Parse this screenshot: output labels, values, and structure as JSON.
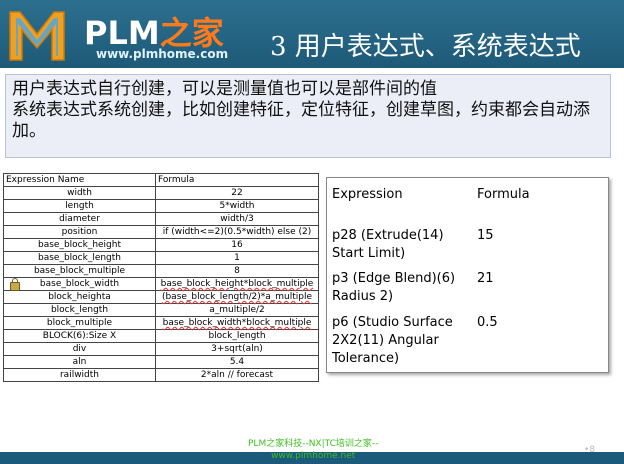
{
  "header": {
    "brand_prefix": "PLM",
    "brand_suffix": "之家",
    "brand_url": "www.plmhome.com",
    "title": "3 用户表达式、系统表达式",
    "colors": {
      "bar": "#1e5a78",
      "accent": "#ff7a1a"
    }
  },
  "description": {
    "line1": "用户表达式自行创建，可以是测量值也可以是部件间的值",
    "line2": "系统表达式系统创建，比如创建特征，定位特征，创建草图，约束都会自动添加。"
  },
  "left_table": {
    "headers": [
      "Expression Name",
      "Formula"
    ],
    "rows": [
      {
        "name": "width",
        "formula": "22"
      },
      {
        "name": "length",
        "formula": "5*width"
      },
      {
        "name": "diameter",
        "formula": "width/3"
      },
      {
        "name": "position",
        "formula": "if (width<=2)(0.5*width)  else (2)"
      },
      {
        "name": "base_block_height",
        "formula": "16"
      },
      {
        "name": "base_block_length",
        "formula": "1"
      },
      {
        "name": "base_block_multiple",
        "formula": "8"
      },
      {
        "name": "base_block_width",
        "formula": "base_block_height*block_multiple",
        "locked": true
      },
      {
        "name": "block_heighta",
        "formula": "(base_block_length/2)*a_multiple"
      },
      {
        "name": "block_length",
        "formula": "a_multiple/2"
      },
      {
        "name": "block_multiple",
        "formula": "base_block_width*block_multiple"
      },
      {
        "name": "BLOCK(6):Size X",
        "formula": "block_length"
      },
      {
        "name": "div",
        "formula": "3+sqrt(aln)"
      },
      {
        "name": "aln",
        "formula": "5.4"
      },
      {
        "name": "railwidth",
        "formula": "2*aln // forecast"
      }
    ]
  },
  "right_panel": {
    "headers": [
      "Expression",
      "Formula"
    ],
    "rows": [
      {
        "name": "p28 (Extrude(14) Start Limit)",
        "value": "15"
      },
      {
        "name": "p3 (Edge Blend)(6) Radius 2)",
        "value": "21"
      },
      {
        "name": "p6 (Studio Surface 2X2(11) Angular Tolerance)",
        "value": "0.5"
      }
    ]
  },
  "footer": {
    "line1": "PLM之家科技--NX|TC培训之家--",
    "line2": "www.plmhome.net",
    "page_number": "8"
  }
}
